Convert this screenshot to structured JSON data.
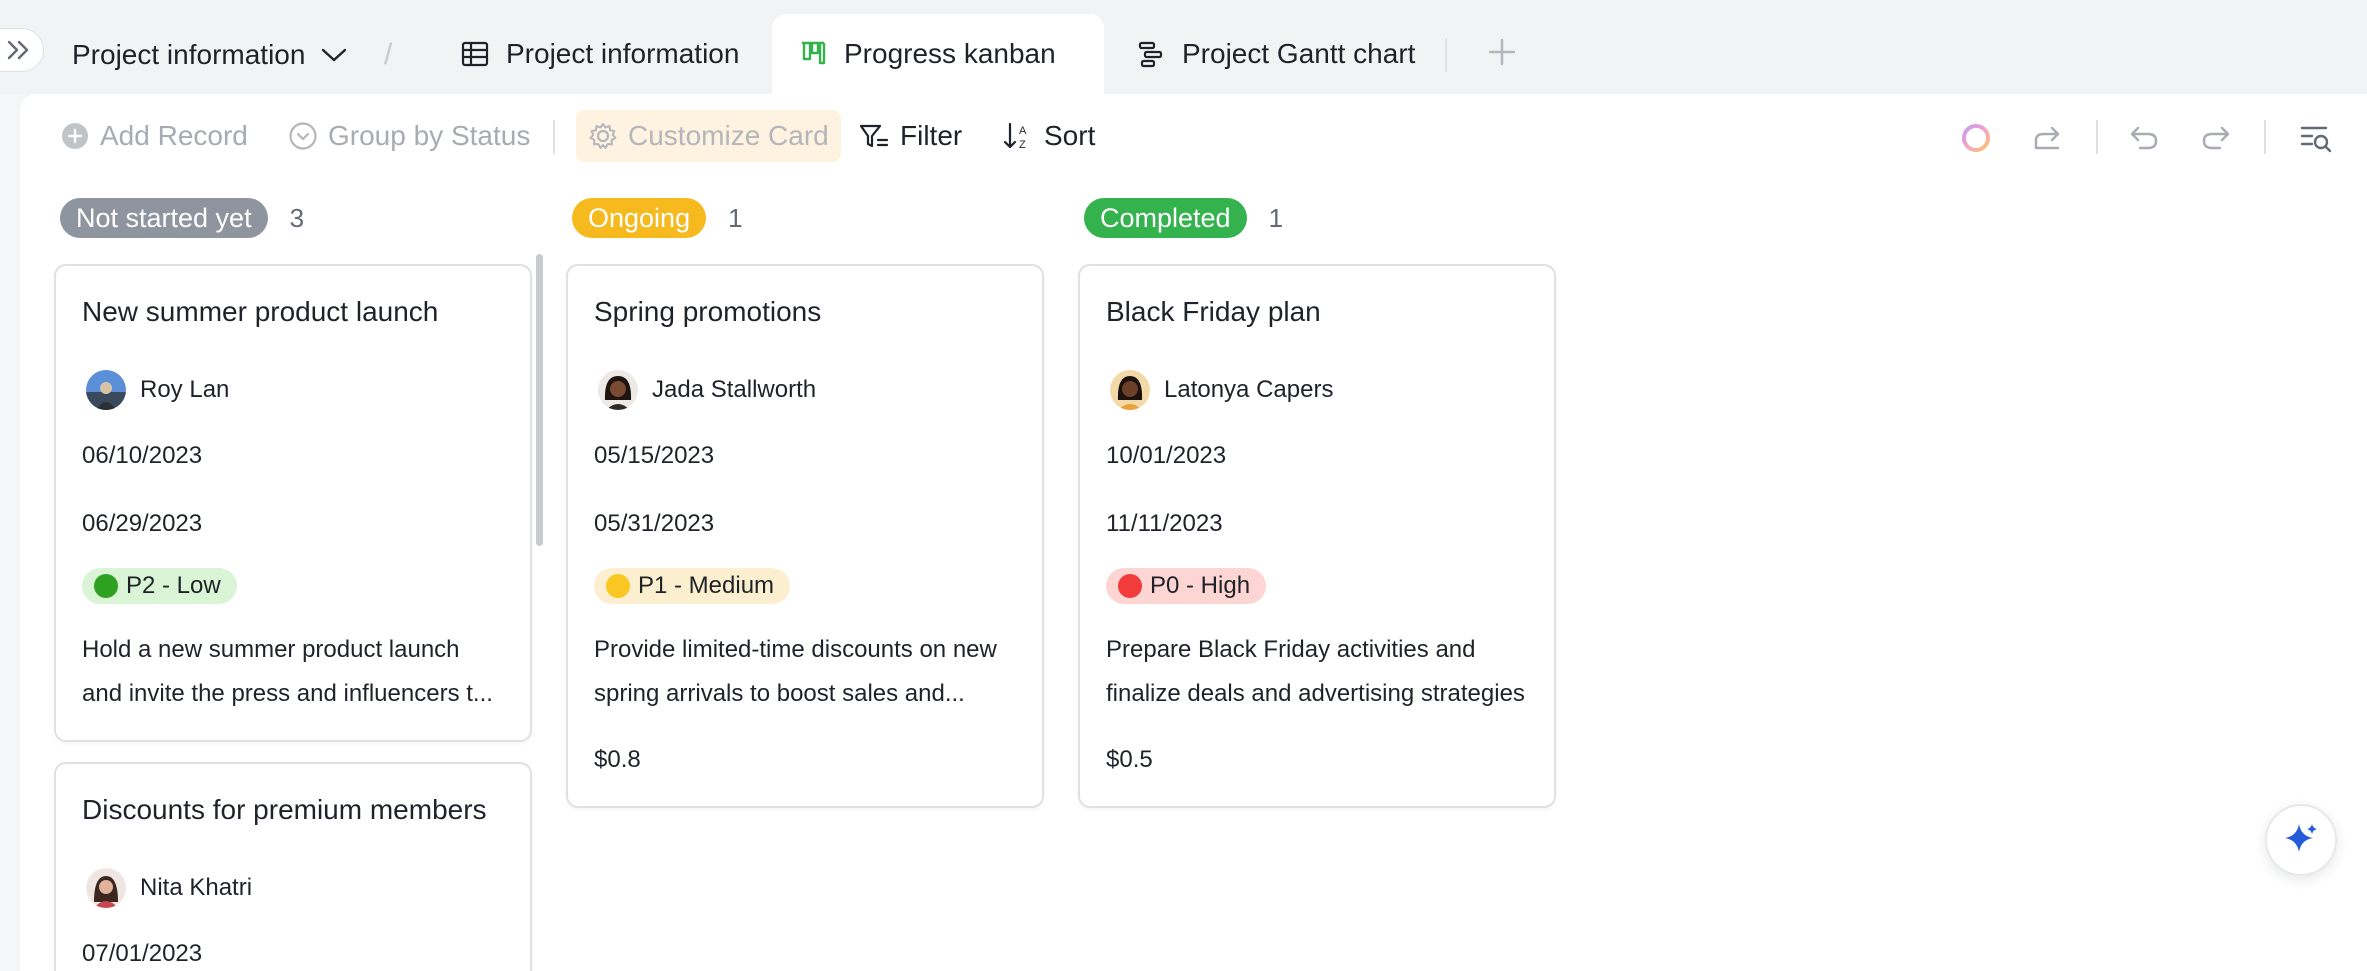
{
  "topbar": {
    "project_select": "Project information",
    "separator": "/",
    "tabs": [
      {
        "label": "Project information",
        "icon": "grid-table-icon"
      },
      {
        "label": "Progress kanban",
        "icon": "kanban-icon",
        "active": true
      },
      {
        "label": "Project Gantt chart",
        "icon": "gantt-icon"
      }
    ],
    "add_tab_icon": "plus-icon"
  },
  "toolbar": {
    "add_record": "Add Record",
    "group_by": "Group by Status",
    "customize_card": "Customize Card",
    "filter": "Filter",
    "sort": "Sort",
    "right_icons": [
      "ai-ring-icon",
      "share-icon",
      "undo-icon",
      "redo-icon",
      "search-list-icon"
    ]
  },
  "colors": {
    "not_started": "#8f959e",
    "ongoing": "#f7ba1e",
    "completed": "#34b24d",
    "low_bg": "#d9f5d6",
    "low_dot": "#2ea121",
    "medium_bg": "#fcefd0",
    "medium_dot": "#fac723",
    "high_bg": "#fdd5d3",
    "high_dot": "#f23c3c",
    "ai_accent": "#245bdb"
  },
  "columns": [
    {
      "status": "Not started yet",
      "count": "3",
      "cards": [
        {
          "title": "New summer product launch",
          "owner": "Roy Lan",
          "start": "06/10/2023",
          "end": "06/29/2023",
          "priority": "P2 - Low",
          "desc_line1": "Hold a new summer product launch",
          "desc_line2": "and invite the press and influencers t..."
        },
        {
          "title": "Discounts for premium members",
          "owner": "Nita Khatri",
          "start": "07/01/2023"
        }
      ]
    },
    {
      "status": "Ongoing",
      "count": "1",
      "cards": [
        {
          "title": "Spring promotions",
          "owner": "Jada Stallworth",
          "start": "05/15/2023",
          "end": "05/31/2023",
          "priority": "P1 - Medium",
          "desc_line1": "Provide limited-time discounts on new",
          "desc_line2": "spring arrivals to boost sales and...",
          "amount": "$0.8"
        }
      ]
    },
    {
      "status": "Completed",
      "count": "1",
      "cards": [
        {
          "title": "Black Friday plan",
          "owner": "Latonya Capers",
          "start": "10/01/2023",
          "end": "11/11/2023",
          "priority": "P0 - High",
          "desc_line1": "Prepare Black Friday activities and",
          "desc_line2": "finalize deals and advertising strategies",
          "amount": "$0.5"
        }
      ]
    }
  ]
}
